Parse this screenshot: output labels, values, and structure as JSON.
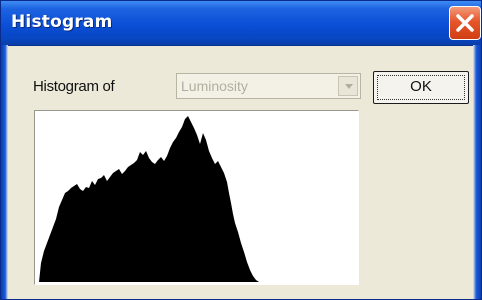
{
  "window": {
    "title": "Histogram"
  },
  "controls": {
    "histogram_of_label": "Histogram of",
    "channel_select_value": "Luminosity",
    "ok_label": "OK"
  },
  "icons": {
    "close": "close-icon",
    "dropdown": "chevron-down-icon"
  },
  "colors": {
    "title_bar": "#0a4fd6",
    "close_button": "#e5562a",
    "dialog_background": "#ece9d8",
    "histogram_fill": "#000000"
  }
}
